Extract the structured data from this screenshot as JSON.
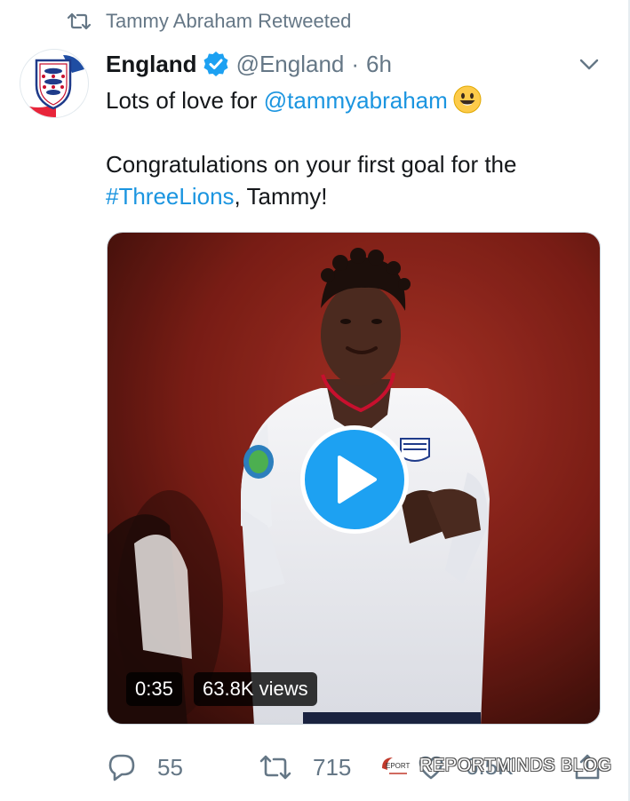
{
  "retweet": {
    "icon": "retweet-icon",
    "text": "Tammy Abraham Retweeted"
  },
  "tweet": {
    "author_name": "England",
    "verified_icon": "verified-badge-icon",
    "handle": "@England",
    "separator": "·",
    "time": "6h",
    "menu_icon": "chevron-down-icon",
    "line1_prefix": "Lots of love for ",
    "line1_mention": "@tammyabraham",
    "line1_emoji": "smiley-emoji-icon",
    "line2": "Congratulations on your first goal for the",
    "line3_hashtag": "#ThreeLions",
    "line3_suffix": ", Tammy!"
  },
  "media": {
    "play_icon": "play-icon",
    "duration": "0:35",
    "views": "63.8K views"
  },
  "actions": {
    "reply_count": "55",
    "retweet_count": "715",
    "like_count": "6.5K"
  },
  "watermark": {
    "logo_text": "EPORT",
    "text": "REPORTMINDS BLOG"
  },
  "colors": {
    "link": "#1b95e0",
    "secondary": "#657786",
    "accent": "#1da1f2"
  }
}
